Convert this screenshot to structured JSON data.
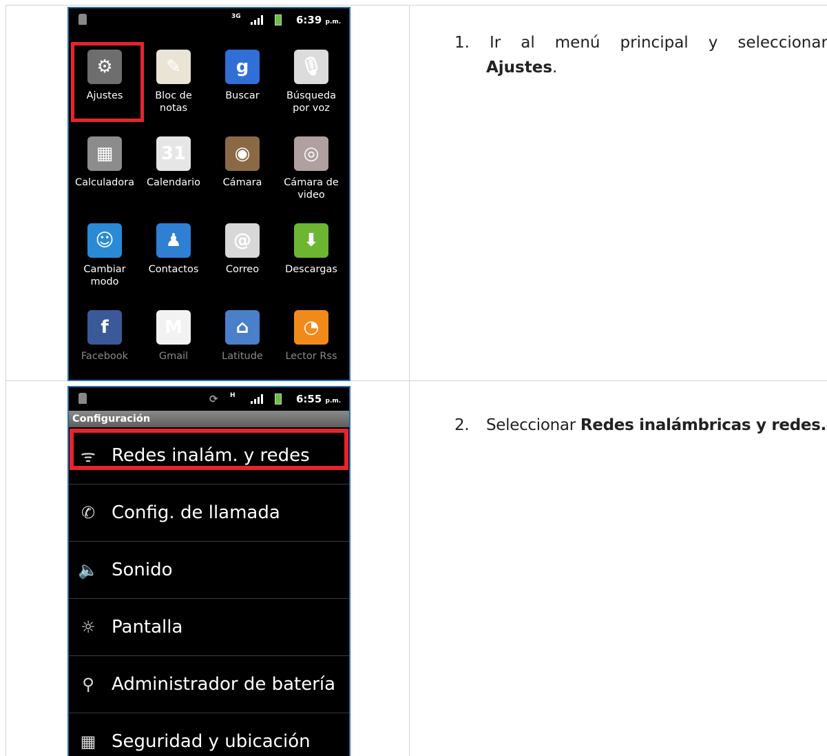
{
  "steps": [
    {
      "number": "1.",
      "words": [
        "Ir",
        "al",
        "menú",
        "principal",
        "y",
        "seleccionar"
      ],
      "bold": "Ajustes",
      "suffix": "."
    },
    {
      "number": "2.",
      "text": "Seleccionar ",
      "bold": "Redes inalámbricas y redes."
    }
  ],
  "phone1": {
    "status_time": "6:39",
    "status_ampm": "p.m.",
    "network": "3G",
    "apps": [
      {
        "label": "Ajustes",
        "icon": "gear-icon",
        "color": "#6e6e6e",
        "glyph": "⚙"
      },
      {
        "label": "Bloc de notas",
        "icon": "notepad-icon",
        "color": "#e9e4d4",
        "glyph": "✎"
      },
      {
        "label": "Buscar",
        "icon": "google-search-icon",
        "color": "#2f6fd6",
        "glyph": "g"
      },
      {
        "label": "Búsqueda por voz",
        "icon": "microphone-icon",
        "color": "#dcdcdc",
        "glyph": "🎙"
      },
      {
        "label": "Calculadora",
        "icon": "calculator-icon",
        "color": "#8c8c8c",
        "glyph": "▦"
      },
      {
        "label": "Calendario",
        "icon": "calendar-icon",
        "color": "#e6e6e6",
        "glyph": "31"
      },
      {
        "label": "Cámara",
        "icon": "camera-icon",
        "color": "#8a6a45",
        "glyph": "◉"
      },
      {
        "label": "Cámara de video",
        "icon": "video-camera-icon",
        "color": "#b0a0a0",
        "glyph": "◎"
      },
      {
        "label": "Cambiar modo",
        "icon": "mode-switch-icon",
        "color": "#2a8ad6",
        "glyph": "☺"
      },
      {
        "label": "Contactos",
        "icon": "contacts-icon",
        "color": "#2f7fd4",
        "glyph": "♟"
      },
      {
        "label": "Correo",
        "icon": "mail-icon",
        "color": "#d8d8d8",
        "glyph": "@"
      },
      {
        "label": "Descargas",
        "icon": "download-icon",
        "color": "#6cb632",
        "glyph": "⬇"
      },
      {
        "label": "Facebook",
        "icon": "facebook-icon",
        "color": "#3b5998",
        "glyph": "f",
        "dim": true
      },
      {
        "label": "Gmail",
        "icon": "gmail-icon",
        "color": "#f2f2f2",
        "glyph": "M",
        "dim": true
      },
      {
        "label": "Latitude",
        "icon": "latitude-icon",
        "color": "#4a7fc9",
        "glyph": "⌂",
        "dim": true
      },
      {
        "label": "Lector Rss",
        "icon": "rss-icon",
        "color": "#f28a1b",
        "glyph": "◔",
        "dim": true
      }
    ]
  },
  "phone2": {
    "status_time": "6:55",
    "status_ampm": "p.m.",
    "network": "H",
    "title": "Configuración",
    "items": [
      {
        "label": "Redes inalám. y redes",
        "icon": "wifi-icon",
        "glyph": "ᯤ"
      },
      {
        "label": "Config. de llamada",
        "icon": "phone-handset-icon",
        "glyph": "✆"
      },
      {
        "label": "Sonido",
        "icon": "speaker-icon",
        "glyph": "🔈"
      },
      {
        "label": "Pantalla",
        "icon": "brightness-icon",
        "glyph": "☼"
      },
      {
        "label": "Administrador de batería",
        "icon": "battery-manager-icon",
        "glyph": "⚲"
      },
      {
        "label": "Seguridad y ubicación",
        "icon": "security-grid-icon",
        "glyph": "▦"
      }
    ]
  }
}
